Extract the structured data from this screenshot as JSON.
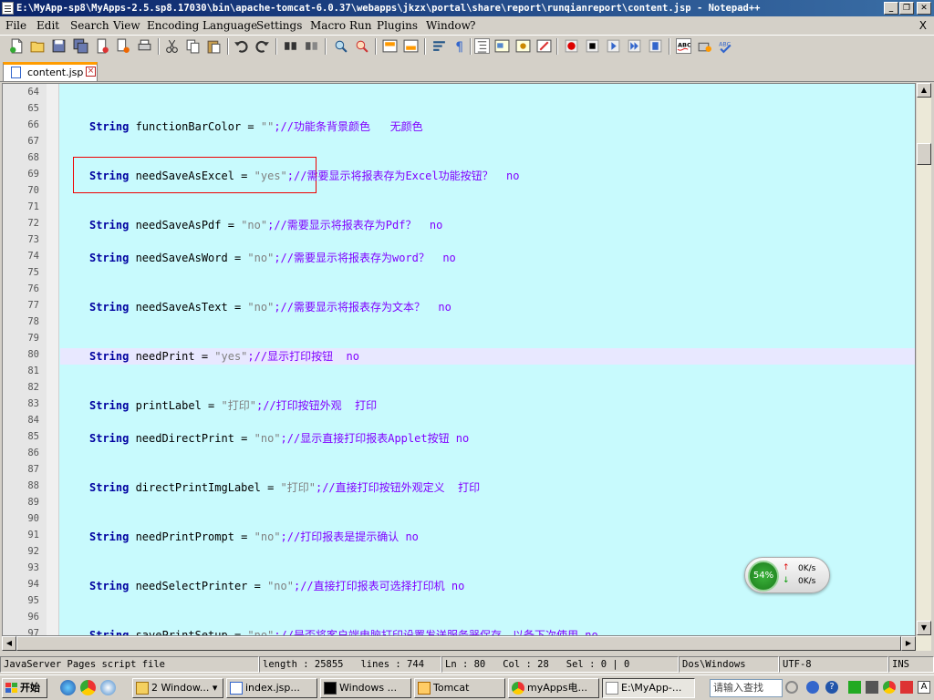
{
  "window": {
    "title": "E:\\MyApp-sp8\\MyApps-2.5.sp8.17030\\bin\\apache-tomcat-6.0.37\\webapps\\jkzx\\portal\\share\\report\\runqianreport\\content.jsp - Notepad++"
  },
  "menu": {
    "items": [
      "File",
      "Edit",
      "Search",
      "View",
      "Encoding",
      "Language",
      "Settings",
      "Macro",
      "Run",
      "Plugins",
      "Window",
      "?"
    ],
    "close_glyph": "X"
  },
  "tab": {
    "label": "content.jsp"
  },
  "editor": {
    "lines": [
      {
        "n": "64"
      },
      {
        "n": "65"
      },
      {
        "n": "66",
        "kw": "String",
        "name": " functionBarColor = ",
        "str": "\"\"",
        "rest": ";//功能条背景颜色   无颜色"
      },
      {
        "n": "67"
      },
      {
        "n": "68"
      },
      {
        "n": "69",
        "kw": "String",
        "name": " needSaveAsExcel = ",
        "str": "\"yes\"",
        "rest": ";//需要显示将报表存为Excel功能按钮？  no"
      },
      {
        "n": "70"
      },
      {
        "n": "71"
      },
      {
        "n": "72",
        "kw": "String",
        "name": " needSaveAsPdf = ",
        "str": "\"no\"",
        "rest": ";//需要显示将报表存为Pdf？  no"
      },
      {
        "n": "73"
      },
      {
        "n": "74",
        "kw": "String",
        "name": " needSaveAsWord = ",
        "str": "\"no\"",
        "rest": ";//需要显示将报表存为word？  no"
      },
      {
        "n": "75"
      },
      {
        "n": "76"
      },
      {
        "n": "77",
        "kw": "String",
        "name": " needSaveAsText = ",
        "str": "\"no\"",
        "rest": ";//需要显示将报表存为文本？  no"
      },
      {
        "n": "78"
      },
      {
        "n": "79"
      },
      {
        "n": "80",
        "kw": "String",
        "name": " needPrint = ",
        "str": "\"yes\"",
        "rest": ";//显示打印按钮  no"
      },
      {
        "n": "81"
      },
      {
        "n": "82"
      },
      {
        "n": "83",
        "kw": "String",
        "name": " printLabel = ",
        "str": "\"打印\"",
        "rest": ";//打印按钮外观  打印"
      },
      {
        "n": "84"
      },
      {
        "n": "85",
        "kw": "String",
        "name": " needDirectPrint = ",
        "str": "\"no\"",
        "rest": ";//显示直接打印报表Applet按钮 no"
      },
      {
        "n": "86"
      },
      {
        "n": "87"
      },
      {
        "n": "88",
        "kw": "String",
        "name": " directPrintImgLabel = ",
        "str": "\"打印\"",
        "rest": ";//直接打印按钮外观定义  打印"
      },
      {
        "n": "89"
      },
      {
        "n": "90"
      },
      {
        "n": "91",
        "kw": "String",
        "name": " needPrintPrompt = ",
        "str": "\"no\"",
        "rest": ";//打印报表是提示确认 no"
      },
      {
        "n": "92"
      },
      {
        "n": "93"
      },
      {
        "n": "94",
        "kw": "String",
        "name": " needSelectPrinter = ",
        "str": "\"no\"",
        "rest": ";//直接打印报表可选择打印机 no"
      },
      {
        "n": "95"
      },
      {
        "n": "96"
      },
      {
        "n": "97",
        "kw": "String",
        "name": " savePrintSetup = ",
        "str": "\"no\"",
        "rest": ";//是否将客户端电脑打印设置发送服务器保存，以备下次使用 no"
      }
    ]
  },
  "status": {
    "filetype": "JavaServer Pages script file",
    "length": "length : 25855",
    "lines": "lines : 744",
    "ln": "Ln : 80",
    "col": "Col : 28",
    "sel": "Sel : 0 | 0",
    "eol": "Dos\\Windows",
    "encoding": "UTF-8",
    "mode": "INS"
  },
  "net_widget": {
    "percent": "54%",
    "percent_value": 54,
    "up": "0K/s",
    "down": "0K/s"
  },
  "taskbar": {
    "start": "开始",
    "buttons": [
      "2 Window...",
      "index.jsp...",
      "Windows ...",
      "Tomcat",
      "myApps电...",
      "E:\\MyApp-..."
    ],
    "search_placeholder": "请输入查找"
  },
  "colors": {
    "editor_bg": "#c8fafd",
    "keyword": "#0000a0",
    "string": "#808080",
    "comment": "#8000ff",
    "highlight_box": "#ee0000"
  }
}
